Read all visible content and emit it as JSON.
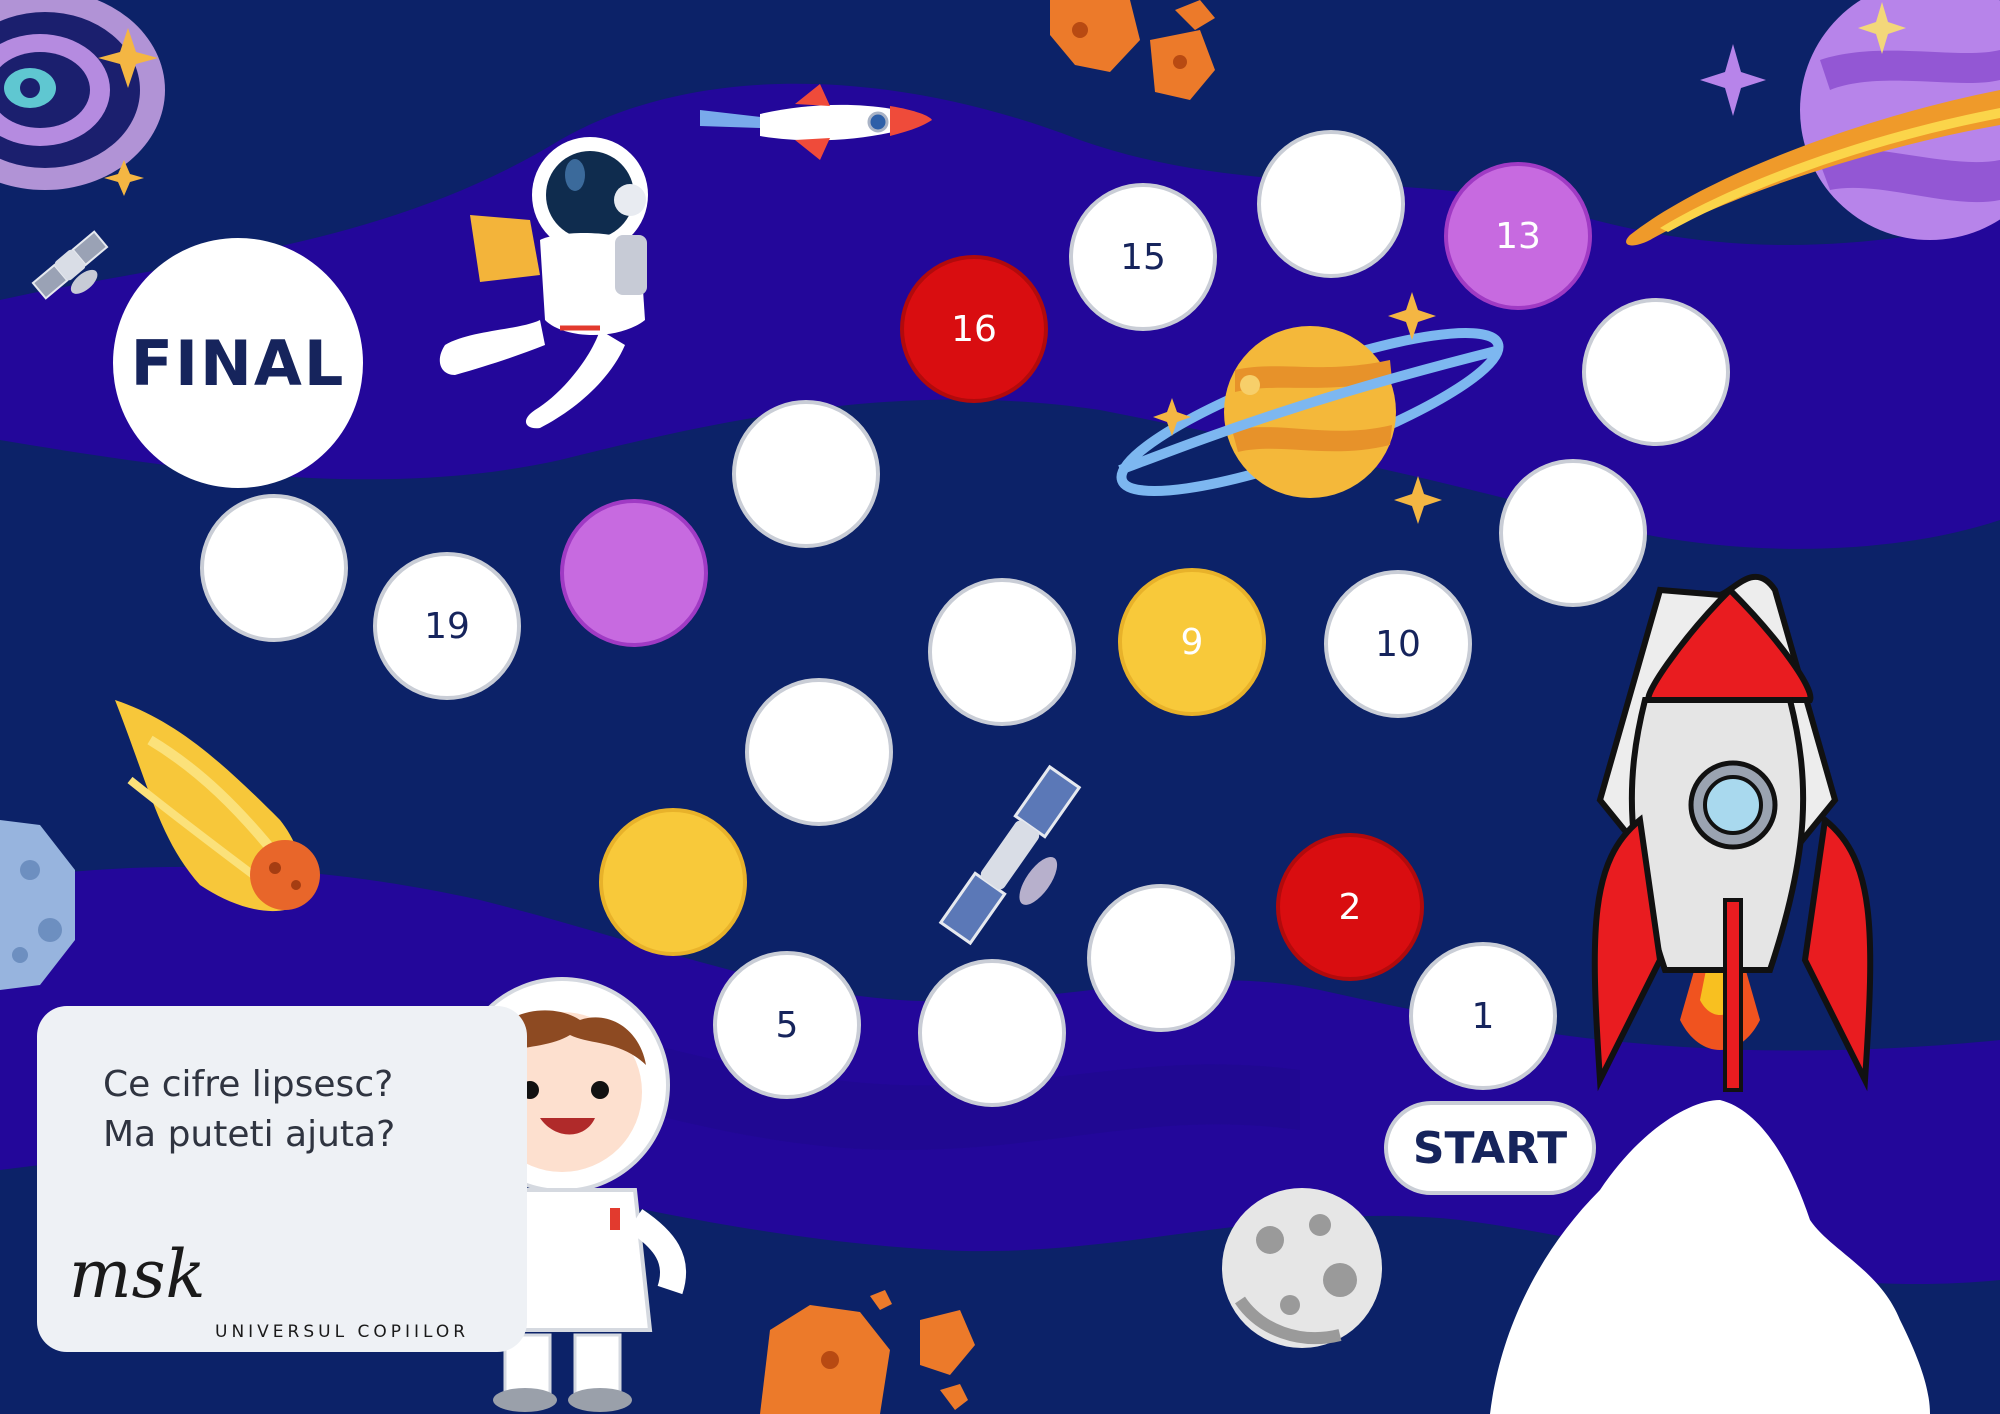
{
  "board": {
    "final_label": "FINAL",
    "start_label": "START"
  },
  "spaces": [
    {
      "label": "1",
      "color": "white"
    },
    {
      "label": "2",
      "color": "red"
    },
    {
      "label": "",
      "color": "white"
    },
    {
      "label": "",
      "color": "white"
    },
    {
      "label": "5",
      "color": "white"
    },
    {
      "label": "",
      "color": "yellow"
    },
    {
      "label": "",
      "color": "white"
    },
    {
      "label": "",
      "color": "white"
    },
    {
      "label": "9",
      "color": "yellow"
    },
    {
      "label": "10",
      "color": "white"
    },
    {
      "label": "",
      "color": "white"
    },
    {
      "label": "",
      "color": "white"
    },
    {
      "label": "13",
      "color": "purple"
    },
    {
      "label": "",
      "color": "white"
    },
    {
      "label": "15",
      "color": "white"
    },
    {
      "label": "16",
      "color": "red"
    },
    {
      "label": "",
      "color": "white"
    },
    {
      "label": "",
      "color": "purple"
    },
    {
      "label": "19",
      "color": "white"
    },
    {
      "label": "",
      "color": "white"
    }
  ],
  "question": {
    "line1": "Ce cifre lipsesc?",
    "line2": "Ma puteti ajuta?"
  },
  "brand": {
    "script": "msk",
    "subtitle": "UNIVERSUL COPIILOR"
  },
  "colors": {
    "background": "#0c2268",
    "band": "#24079a",
    "red": "#d90d10",
    "purple": "#c76ae0",
    "yellow": "#f8c93a"
  },
  "icons": [
    "galaxy-icon",
    "satellite-icon",
    "astronaut-icon",
    "rocket-icon",
    "planet-icon",
    "comet-icon",
    "asteroid-icon",
    "moon-icon",
    "star-icon"
  ]
}
